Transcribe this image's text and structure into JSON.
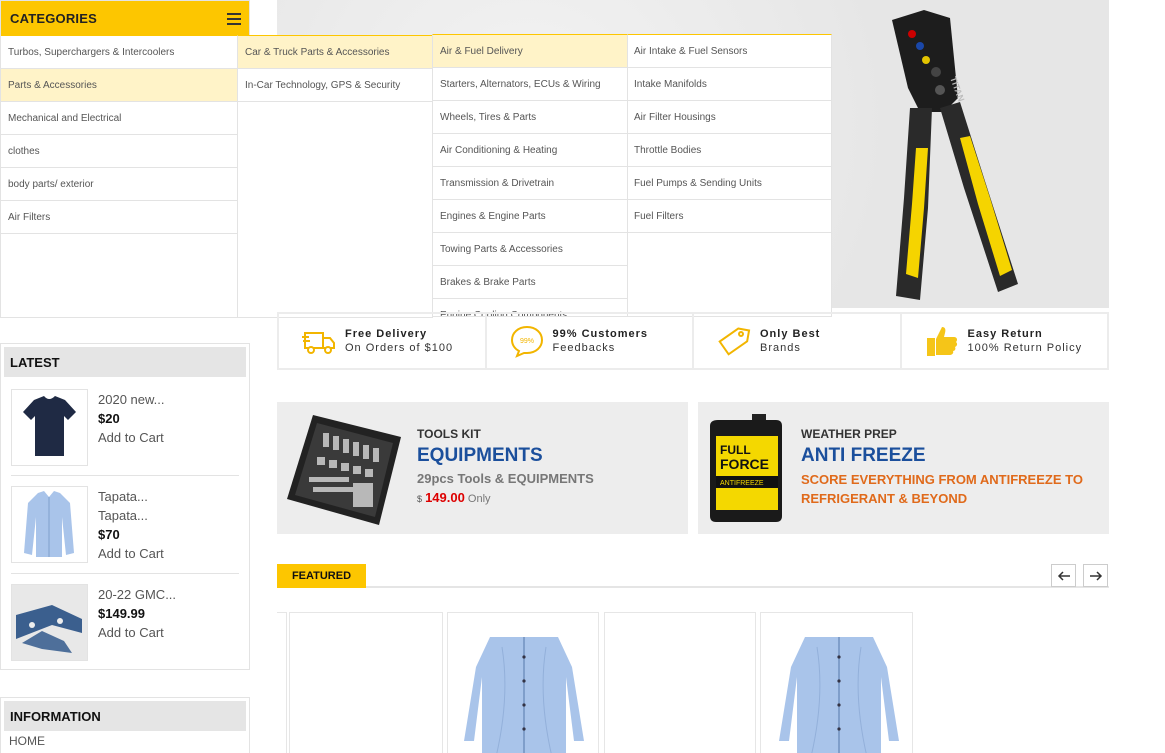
{
  "categories": {
    "title": "CATEGORIES",
    "items": [
      {
        "label": "Turbos, Superchargers & Intercoolers",
        "active": false
      },
      {
        "label": "Parts & Accessories",
        "active": true
      },
      {
        "label": "Mechanical and Electrical",
        "active": false
      },
      {
        "label": "clothes",
        "active": false
      },
      {
        "label": "body parts/ exterior",
        "active": false
      },
      {
        "label": "Air Filters",
        "active": false
      }
    ]
  },
  "dropdown": {
    "col1": [
      "Car & Truck Parts & Accessories",
      "In-Car Technology, GPS & Security"
    ],
    "col2": [
      "Air & Fuel Delivery",
      "Starters, Alternators, ECUs & Wiring",
      "Wheels, Tires & Parts",
      "Air Conditioning & Heating",
      "Transmission & Drivetrain",
      "Engines & Engine Parts",
      "Towing Parts & Accessories",
      "Brakes & Brake Parts",
      "Engine Cooling Components"
    ],
    "col3": [
      "Air Intake & Fuel Sensors",
      "Intake Manifolds",
      "Air Filter Housings",
      "Throttle Bodies",
      "Fuel Pumps & Sending Units",
      "Fuel Filters"
    ]
  },
  "hero": {
    "brand_text": "TITAN"
  },
  "features": [
    {
      "icon": "truck-icon",
      "title": "Free Delivery",
      "sub": "On Orders of $100"
    },
    {
      "icon": "chat-icon",
      "title": "99% Customers",
      "sub": "Feedbacks",
      "badge": "99%"
    },
    {
      "icon": "tag-icon",
      "title": "Only Best",
      "sub": "Brands"
    },
    {
      "icon": "thumbs-up-icon",
      "title": "Easy Return",
      "sub": "100% Return Policy"
    }
  ],
  "latest": {
    "title": "LATEST",
    "products": [
      {
        "name": "2020 new...",
        "name2": "",
        "price": "$20",
        "cart": "Add to Cart",
        "thumb": "tshirt"
      },
      {
        "name": "Tapata...",
        "name2": "Tapata...",
        "price": "$70",
        "cart": "Add to Cart",
        "thumb": "shirt"
      },
      {
        "name": "20-22 GMC...",
        "name2": "",
        "price": "$149.99",
        "cart": "Add to Cart",
        "thumb": "part"
      }
    ]
  },
  "information": {
    "title": "INFORMATION",
    "link": "HOME"
  },
  "promos": [
    {
      "kicker": "TOOLS KIT",
      "head": "EQUIPMENTS",
      "sub": "29pcs Tools & EQUIPMENTS",
      "currency": "$",
      "price": "149.00",
      "suffix": "Only"
    },
    {
      "kicker": "WEATHER PREP",
      "head": "ANTI FREEZE",
      "sub": "SCORE EVERYTHING FROM ANTIFREEZE TO REFRIGERANT & BEYOND",
      "product_text": {
        "l1": "FULL",
        "l2": "FORCE",
        "l3": "ANTIFREEZE"
      }
    }
  ],
  "featured": {
    "title": "FEATURED",
    "prev": "←",
    "next": "→"
  },
  "colors": {
    "accent": "#fdc600",
    "highlight": "#fff3c8",
    "promo_blue": "#1b4f9c",
    "promo_orange": "#e06a1b",
    "price_red": "#dd0000"
  }
}
